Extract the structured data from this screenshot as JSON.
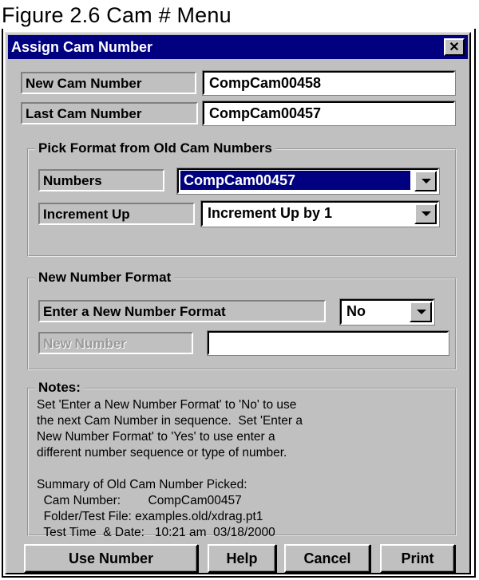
{
  "figure_caption": "Figure 2.6  Cam # Menu",
  "dialog": {
    "title": "Assign Cam Number",
    "close_glyph": "✕"
  },
  "fields": {
    "new_cam_number_label": "New Cam Number",
    "new_cam_number_value": "CompCam00458",
    "last_cam_number_label": "Last Cam Number",
    "last_cam_number_value": "CompCam00457"
  },
  "pick_format": {
    "legend": "Pick Format from Old Cam Numbers",
    "numbers_label": "Numbers",
    "numbers_value": "CompCam00457",
    "increment_label": "Increment Up",
    "increment_value": "Increment Up by 1"
  },
  "new_format": {
    "legend": "New Number Format",
    "enter_label": "Enter a New Number Format",
    "enter_value": "No",
    "new_number_label": "New Number",
    "new_number_value": ""
  },
  "notes": {
    "legend": "Notes:",
    "text": "Set 'Enter a New Number Format' to 'No' to use\nthe next Cam Number in sequence.  Set 'Enter a\nNew Number Format' to 'Yes' to use enter a\ndifferent number sequence or type of number.\n\nSummary of Old Cam Number Picked:\n  Cam Number:        CompCam00457\n  Folder/Test File: examples.old/xdrag.pt1\n  Test Time  & Date:   10:21 am  03/18/2000"
  },
  "buttons": {
    "use_number": "Use Number",
    "help": "Help",
    "cancel": "Cancel",
    "print": "Print"
  }
}
